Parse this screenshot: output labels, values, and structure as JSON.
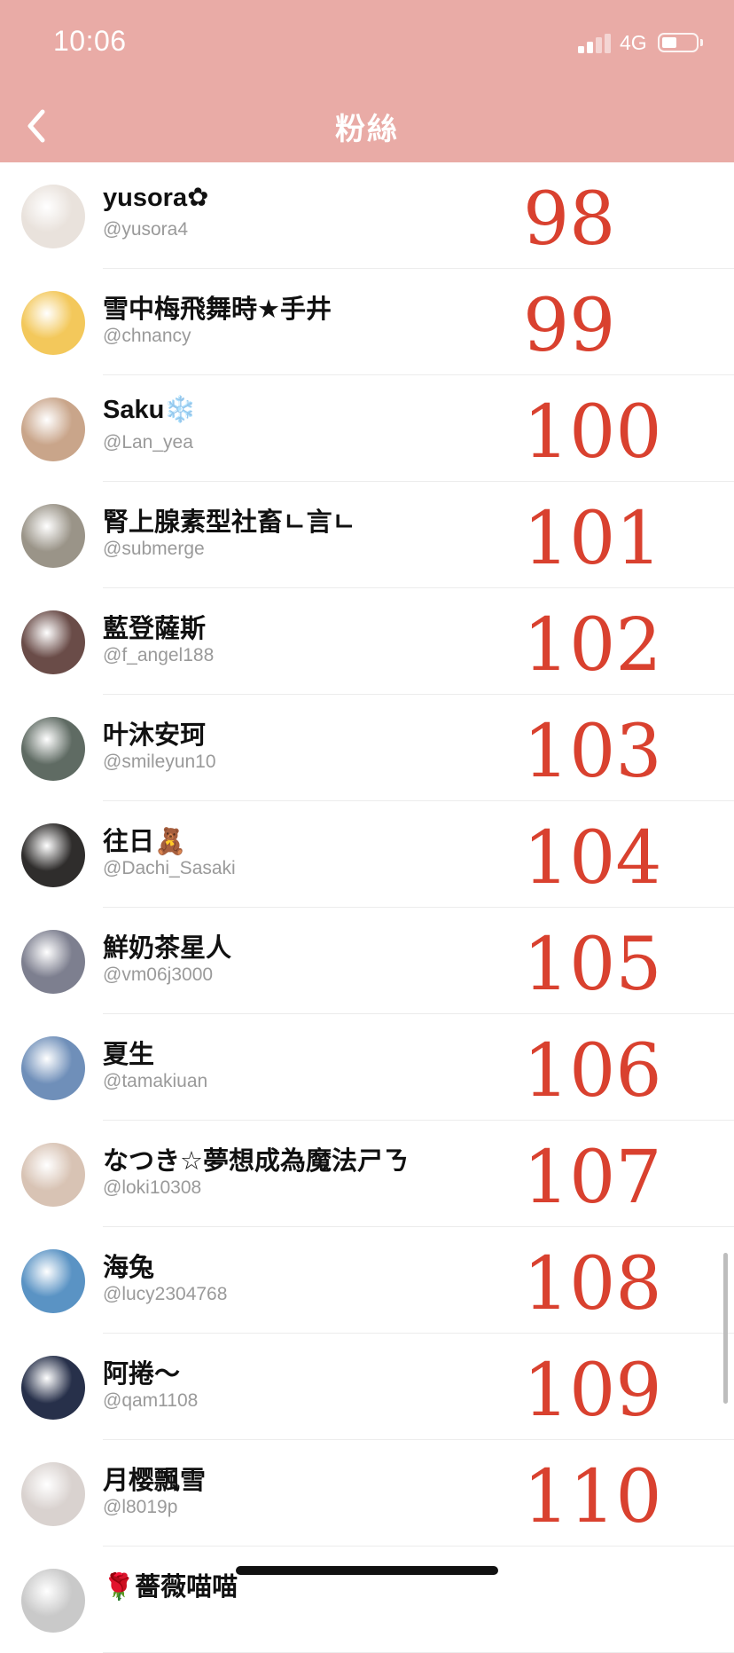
{
  "status_bar": {
    "time": "10:06",
    "network": "4G"
  },
  "header": {
    "title": "粉絲"
  },
  "colors": {
    "header_bg": "#e9aba6",
    "annotation": "#d9412f"
  },
  "followers": [
    {
      "name": "yusora✿",
      "handle": "@yusora4",
      "annotation": "98",
      "avatar_color": "#e9e2dc"
    },
    {
      "name": "雪中梅飛舞時★手井",
      "handle": "@chnancy",
      "annotation": "99",
      "avatar_color": "#f3c85b"
    },
    {
      "name": "Saku❄️",
      "handle": "@Lan_yea",
      "annotation": "100",
      "avatar_color": "#c9a58a"
    },
    {
      "name": "腎上腺素型社畜ㄴ言ㄴ",
      "handle": "@submerge",
      "annotation": "101",
      "avatar_color": "#9a9488"
    },
    {
      "name": "藍登薩斯",
      "handle": "@f_angel188",
      "annotation": "102",
      "avatar_color": "#6a4c48"
    },
    {
      "name": "叶沐安珂",
      "handle": "@smileyun10",
      "annotation": "103",
      "avatar_color": "#5f6b63"
    },
    {
      "name": "往日🧸",
      "handle": "@Dachi_Sasaki",
      "annotation": "104",
      "avatar_color": "#2f2d2c"
    },
    {
      "name": "鮮奶茶星人",
      "handle": "@vm06j3000",
      "annotation": "105",
      "avatar_color": "#7d7f8f"
    },
    {
      "name": "夏生",
      "handle": "@tamakiuan",
      "annotation": "106",
      "avatar_color": "#6f8fb9"
    },
    {
      "name": "なつき☆夢想成為魔法ㄕㄋ",
      "handle": "@loki10308",
      "annotation": "107",
      "avatar_color": "#d8c3b4"
    },
    {
      "name": "海兔",
      "handle": "@lucy2304768",
      "annotation": "108",
      "avatar_color": "#5a93c4"
    },
    {
      "name": "阿捲～",
      "handle": "@qam1108",
      "annotation": "109",
      "avatar_color": "#27304a"
    },
    {
      "name": "月樱飄雪",
      "handle": "@l8019p",
      "annotation": "110",
      "avatar_color": "#d9d2cf"
    },
    {
      "name": "🌹薔薇喵喵",
      "handle": "",
      "annotation": "",
      "avatar_color": "#c9c9c9"
    }
  ]
}
